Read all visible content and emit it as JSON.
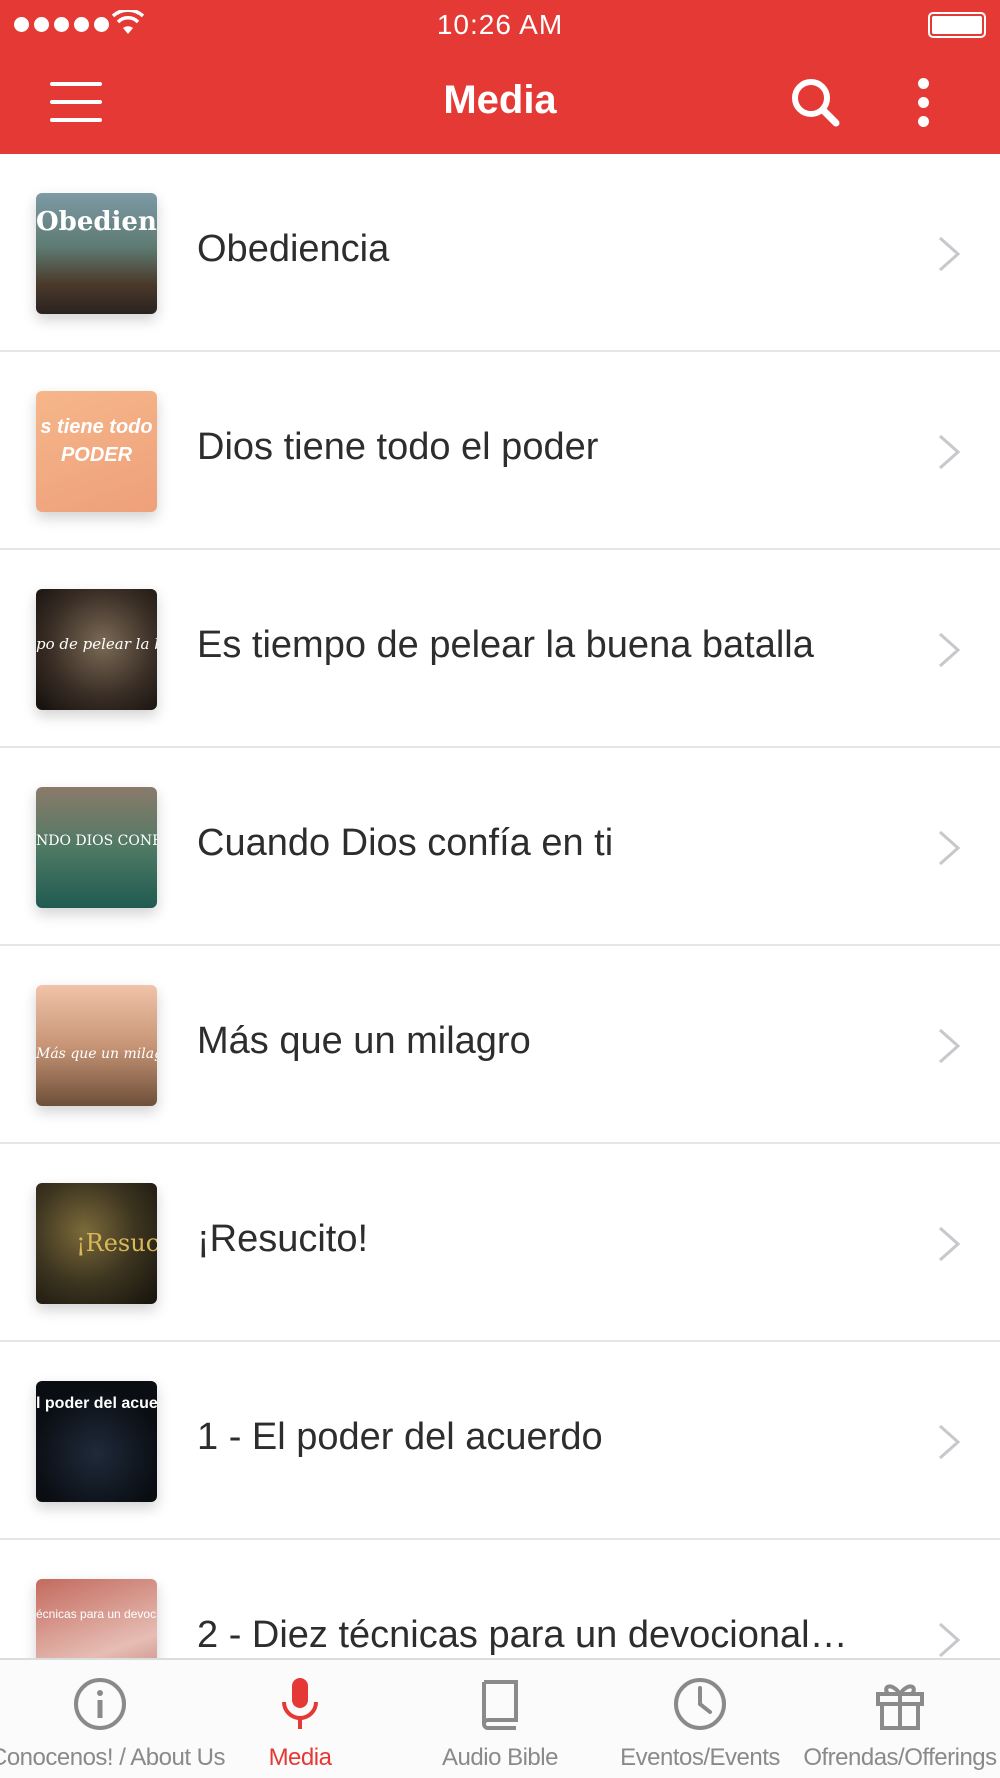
{
  "status_bar": {
    "time": "10:26 AM"
  },
  "app_bar": {
    "title": "Media"
  },
  "colors": {
    "primary": "#e53935",
    "tab_inactive": "#8a8a8a",
    "divider": "#e6e6e6"
  },
  "media_items": [
    {
      "title": "Obediencia",
      "thumb_text": "Obediencia"
    },
    {
      "title": "Dios tiene todo el poder",
      "thumb_text": "s tiene todo PODER"
    },
    {
      "title": "Es tiempo de pelear la buena batalla",
      "thumb_text": "po de pelear la buena"
    },
    {
      "title": "Cuando Dios confía en ti",
      "thumb_text": "NDO DIOS CONFÍA"
    },
    {
      "title": "Más que un milagro",
      "thumb_text": "Más que un milagro"
    },
    {
      "title": "¡Resucito!",
      "thumb_text": "¡Resuci"
    },
    {
      "title": "1 - El poder del acuerdo",
      "thumb_text": "l poder del acuerd"
    },
    {
      "title": "2 - Diez técnicas para un devocional…",
      "thumb_text": "écnicas para un devocion"
    }
  ],
  "tabs": [
    {
      "label": "Conocenos! / About Us",
      "icon": "info-icon",
      "active": false
    },
    {
      "label": "Media",
      "icon": "microphone-icon",
      "active": true
    },
    {
      "label": "Audio Bible",
      "icon": "book-icon",
      "active": false
    },
    {
      "label": "Eventos/Events",
      "icon": "clock-icon",
      "active": false
    },
    {
      "label": "Ofrendas/Offerings",
      "icon": "gift-icon",
      "active": false
    }
  ]
}
